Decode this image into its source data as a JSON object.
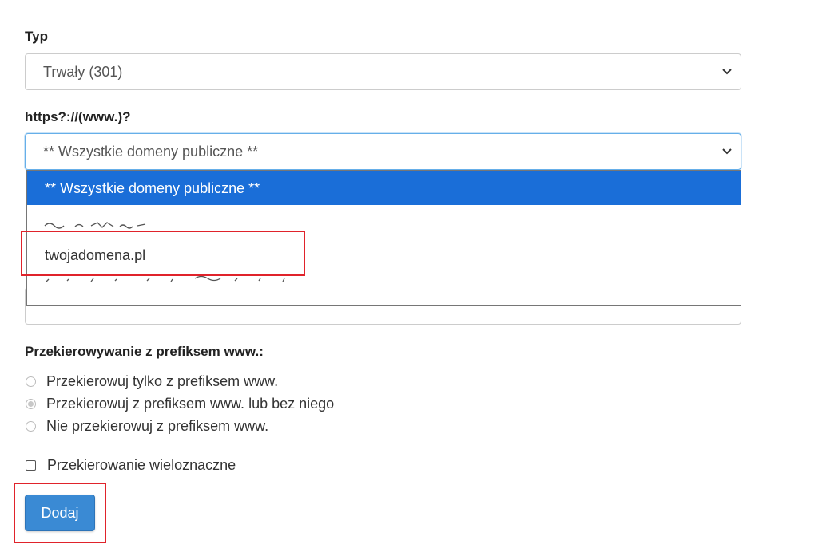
{
  "type_field": {
    "label": "Typ",
    "selected_value": "Trwały (301)"
  },
  "domain_field": {
    "label": "https?://(www.)?",
    "selected_value": "** Wszystkie domeny publiczne **",
    "options": [
      "** Wszystkie domeny publiczne **",
      "",
      "twojadomena.pl",
      ""
    ]
  },
  "www_redirect": {
    "label": "Przekierowywanie z prefiksem www.:",
    "options": [
      {
        "label": "Przekierowuj tylko z prefiksem www.",
        "checked": false
      },
      {
        "label": "Przekierowuj z prefiksem www. lub bez niego",
        "checked": true
      },
      {
        "label": "Nie przekierowuj z prefiksem www.",
        "checked": false
      }
    ]
  },
  "wildcard": {
    "label": "Przekierowanie wieloznaczne",
    "checked": false
  },
  "submit": {
    "label": "Dodaj"
  },
  "colors": {
    "selected_option_bg": "#1a6ed8",
    "button_bg": "#3a8ad4",
    "highlight_border": "#e0232b"
  },
  "icons": {
    "select_arrow": "chevron-down-icon"
  }
}
